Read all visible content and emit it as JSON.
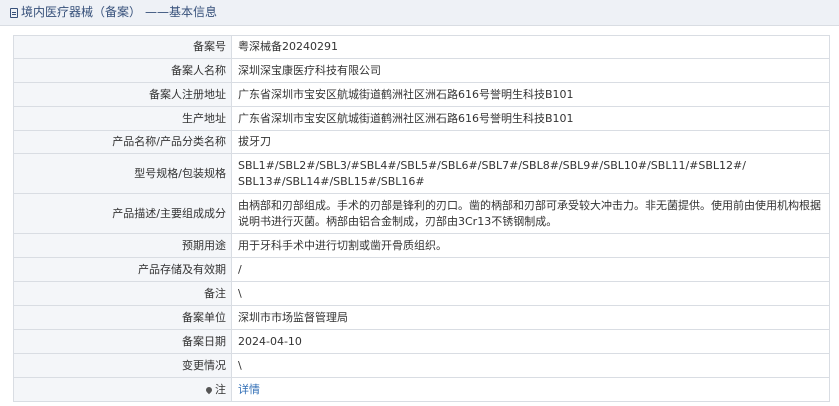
{
  "header": {
    "title": "境内医疗器械（备案）",
    "subtitle": "——基本信息"
  },
  "rows": [
    {
      "label": "备案号",
      "value": "粤深械备20240291"
    },
    {
      "label": "备案人名称",
      "value": "深圳深宝康医疗科技有限公司"
    },
    {
      "label": "备案人注册地址",
      "value": "广东省深圳市宝安区航城街道鹤洲社区洲石路616号誉明生科技B101"
    },
    {
      "label": "生产地址",
      "value": "广东省深圳市宝安区航城街道鹤洲社区洲石路616号誉明生科技B101"
    },
    {
      "label": "产品名称/产品分类名称",
      "value": "拔牙刀"
    },
    {
      "label": "型号规格/包装规格",
      "value": "SBL1#/SBL2#/SBL3/#SBL4#/SBL5#/SBL6#/SBL7#/SBL8#/SBL9#/SBL10#/SBL11/#SBL12#/\nSBL13#/SBL14#/SBL15#/SBL16#"
    },
    {
      "label": "产品描述/主要组成成分",
      "value": "由柄部和刃部组成。手术的刃部是锋利的刃口。凿的柄部和刃部可承受较大冲击力。非无菌提供。使用前由使用机构根据说明书进行灭菌。柄部由铝合金制成，刃部由3Cr13不锈钢制成。"
    },
    {
      "label": "预期用途",
      "value": "用于牙科手术中进行切割或凿开骨质组织。"
    },
    {
      "label": "产品存储及有效期",
      "value": "/"
    },
    {
      "label": "备注",
      "value": "\\"
    },
    {
      "label": "备案单位",
      "value": "深圳市市场监督管理局"
    },
    {
      "label": "备案日期",
      "value": "2024-04-10"
    },
    {
      "label": "变更情况",
      "value": "\\"
    }
  ],
  "note_row": {
    "label": "注",
    "icon": "pin-icon",
    "link_text": "详情"
  },
  "colors": {
    "header_bg": "#eef1f6",
    "label_bg": "#f4f6f9",
    "border": "#d9dde3",
    "link": "#2f6db5"
  }
}
